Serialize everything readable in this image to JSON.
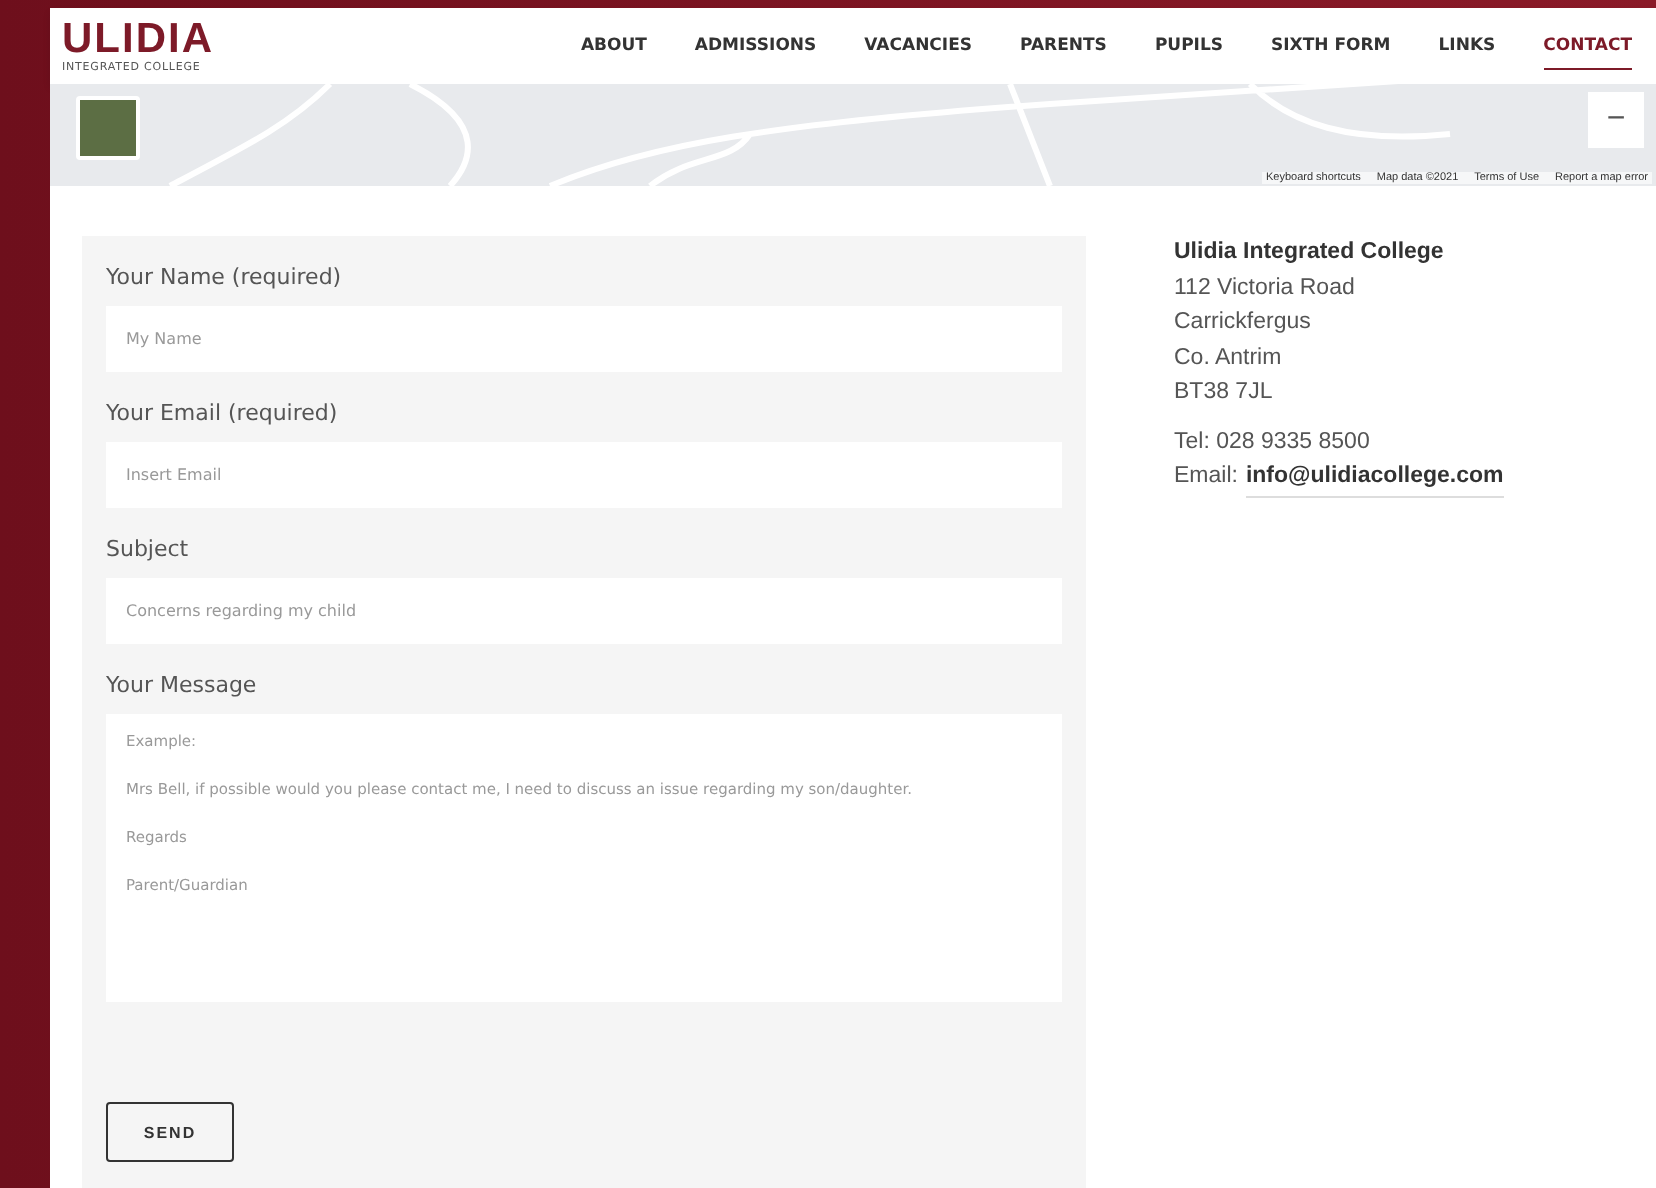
{
  "logo": {
    "name": "ULIDIA",
    "tagline": "INTEGRATED COLLEGE"
  },
  "nav": [
    {
      "label": "ABOUT",
      "selected": false
    },
    {
      "label": "ADMISSIONS",
      "selected": false
    },
    {
      "label": "VACANCIES",
      "selected": false
    },
    {
      "label": "PARENTS",
      "selected": false
    },
    {
      "label": "PUPILS",
      "selected": false
    },
    {
      "label": "SIXTH FORM",
      "selected": false
    },
    {
      "label": "LINKS",
      "selected": false
    },
    {
      "label": "CONTACT",
      "selected": true
    }
  ],
  "map": {
    "zoom_out": "−",
    "attribution": [
      "Keyboard shortcuts",
      "Map data ©2021",
      "Terms of Use",
      "Report a map error"
    ]
  },
  "form": {
    "fields": [
      {
        "kind": "input",
        "label": "Your Name (required)",
        "placeholder": "My Name"
      },
      {
        "kind": "input",
        "label": "Your Email (required)",
        "placeholder": "Insert Email"
      },
      {
        "kind": "input",
        "label": "Subject",
        "placeholder": "Concerns regarding my child"
      },
      {
        "kind": "textarea",
        "label": "Your Message",
        "placeholder": "Example:\n\nMrs Bell, if possible would you please contact me, I need to discuss an issue regarding my son/daughter.\n\nRegards\n\nParent/Guardian"
      }
    ],
    "submit": "SEND"
  },
  "contact": {
    "name": "Ulidia Integrated College",
    "address": [
      "112 Victoria Road",
      "Carrickfergus",
      "Co. Antrim",
      "BT38 7JL"
    ],
    "tel": "Tel: 028 9335 8500",
    "email_label": "Email:",
    "email": "info@ulidiacollege.com"
  }
}
